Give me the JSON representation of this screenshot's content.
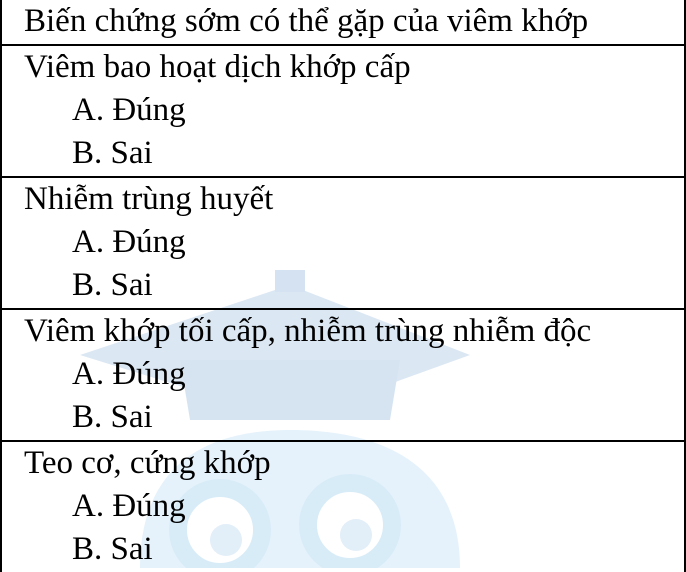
{
  "header": "Biến chứng sớm có thể gặp của viêm khớp",
  "questions": [
    {
      "stem": "Viêm bao hoạt dịch khớp cấp",
      "options": [
        "A. Đúng",
        "B. Sai"
      ]
    },
    {
      "stem": "Nhiễm trùng huyết",
      "options": [
        "A. Đúng",
        "B. Sai"
      ]
    },
    {
      "stem": "Viêm khớp tối cấp, nhiễm trùng nhiễm độc",
      "options": [
        "A. Đúng",
        "B. Sai"
      ]
    },
    {
      "stem": "Teo cơ, cứng khớp",
      "options": [
        "A. Đúng",
        "B. Sai"
      ]
    }
  ],
  "watermark": {
    "icon": "graduation-owl-logo-icon",
    "color_light": "#e6f1fb",
    "color_cap": "#dce8f5"
  }
}
